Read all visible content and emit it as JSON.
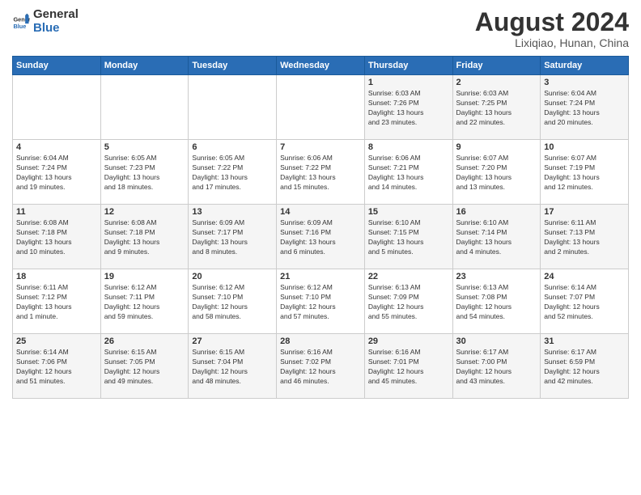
{
  "header": {
    "logo_general": "General",
    "logo_blue": "Blue",
    "month_year": "August 2024",
    "location": "Lixiqiao, Hunan, China"
  },
  "weekdays": [
    "Sunday",
    "Monday",
    "Tuesday",
    "Wednesday",
    "Thursday",
    "Friday",
    "Saturday"
  ],
  "weeks": [
    [
      {
        "day": "",
        "info": ""
      },
      {
        "day": "",
        "info": ""
      },
      {
        "day": "",
        "info": ""
      },
      {
        "day": "",
        "info": ""
      },
      {
        "day": "1",
        "info": "Sunrise: 6:03 AM\nSunset: 7:26 PM\nDaylight: 13 hours\nand 23 minutes."
      },
      {
        "day": "2",
        "info": "Sunrise: 6:03 AM\nSunset: 7:25 PM\nDaylight: 13 hours\nand 22 minutes."
      },
      {
        "day": "3",
        "info": "Sunrise: 6:04 AM\nSunset: 7:24 PM\nDaylight: 13 hours\nand 20 minutes."
      }
    ],
    [
      {
        "day": "4",
        "info": "Sunrise: 6:04 AM\nSunset: 7:24 PM\nDaylight: 13 hours\nand 19 minutes."
      },
      {
        "day": "5",
        "info": "Sunrise: 6:05 AM\nSunset: 7:23 PM\nDaylight: 13 hours\nand 18 minutes."
      },
      {
        "day": "6",
        "info": "Sunrise: 6:05 AM\nSunset: 7:22 PM\nDaylight: 13 hours\nand 17 minutes."
      },
      {
        "day": "7",
        "info": "Sunrise: 6:06 AM\nSunset: 7:22 PM\nDaylight: 13 hours\nand 15 minutes."
      },
      {
        "day": "8",
        "info": "Sunrise: 6:06 AM\nSunset: 7:21 PM\nDaylight: 13 hours\nand 14 minutes."
      },
      {
        "day": "9",
        "info": "Sunrise: 6:07 AM\nSunset: 7:20 PM\nDaylight: 13 hours\nand 13 minutes."
      },
      {
        "day": "10",
        "info": "Sunrise: 6:07 AM\nSunset: 7:19 PM\nDaylight: 13 hours\nand 12 minutes."
      }
    ],
    [
      {
        "day": "11",
        "info": "Sunrise: 6:08 AM\nSunset: 7:18 PM\nDaylight: 13 hours\nand 10 minutes."
      },
      {
        "day": "12",
        "info": "Sunrise: 6:08 AM\nSunset: 7:18 PM\nDaylight: 13 hours\nand 9 minutes."
      },
      {
        "day": "13",
        "info": "Sunrise: 6:09 AM\nSunset: 7:17 PM\nDaylight: 13 hours\nand 8 minutes."
      },
      {
        "day": "14",
        "info": "Sunrise: 6:09 AM\nSunset: 7:16 PM\nDaylight: 13 hours\nand 6 minutes."
      },
      {
        "day": "15",
        "info": "Sunrise: 6:10 AM\nSunset: 7:15 PM\nDaylight: 13 hours\nand 5 minutes."
      },
      {
        "day": "16",
        "info": "Sunrise: 6:10 AM\nSunset: 7:14 PM\nDaylight: 13 hours\nand 4 minutes."
      },
      {
        "day": "17",
        "info": "Sunrise: 6:11 AM\nSunset: 7:13 PM\nDaylight: 13 hours\nand 2 minutes."
      }
    ],
    [
      {
        "day": "18",
        "info": "Sunrise: 6:11 AM\nSunset: 7:12 PM\nDaylight: 13 hours\nand 1 minute."
      },
      {
        "day": "19",
        "info": "Sunrise: 6:12 AM\nSunset: 7:11 PM\nDaylight: 12 hours\nand 59 minutes."
      },
      {
        "day": "20",
        "info": "Sunrise: 6:12 AM\nSunset: 7:10 PM\nDaylight: 12 hours\nand 58 minutes."
      },
      {
        "day": "21",
        "info": "Sunrise: 6:12 AM\nSunset: 7:10 PM\nDaylight: 12 hours\nand 57 minutes."
      },
      {
        "day": "22",
        "info": "Sunrise: 6:13 AM\nSunset: 7:09 PM\nDaylight: 12 hours\nand 55 minutes."
      },
      {
        "day": "23",
        "info": "Sunrise: 6:13 AM\nSunset: 7:08 PM\nDaylight: 12 hours\nand 54 minutes."
      },
      {
        "day": "24",
        "info": "Sunrise: 6:14 AM\nSunset: 7:07 PM\nDaylight: 12 hours\nand 52 minutes."
      }
    ],
    [
      {
        "day": "25",
        "info": "Sunrise: 6:14 AM\nSunset: 7:06 PM\nDaylight: 12 hours\nand 51 minutes."
      },
      {
        "day": "26",
        "info": "Sunrise: 6:15 AM\nSunset: 7:05 PM\nDaylight: 12 hours\nand 49 minutes."
      },
      {
        "day": "27",
        "info": "Sunrise: 6:15 AM\nSunset: 7:04 PM\nDaylight: 12 hours\nand 48 minutes."
      },
      {
        "day": "28",
        "info": "Sunrise: 6:16 AM\nSunset: 7:02 PM\nDaylight: 12 hours\nand 46 minutes."
      },
      {
        "day": "29",
        "info": "Sunrise: 6:16 AM\nSunset: 7:01 PM\nDaylight: 12 hours\nand 45 minutes."
      },
      {
        "day": "30",
        "info": "Sunrise: 6:17 AM\nSunset: 7:00 PM\nDaylight: 12 hours\nand 43 minutes."
      },
      {
        "day": "31",
        "info": "Sunrise: 6:17 AM\nSunset: 6:59 PM\nDaylight: 12 hours\nand 42 minutes."
      }
    ]
  ]
}
